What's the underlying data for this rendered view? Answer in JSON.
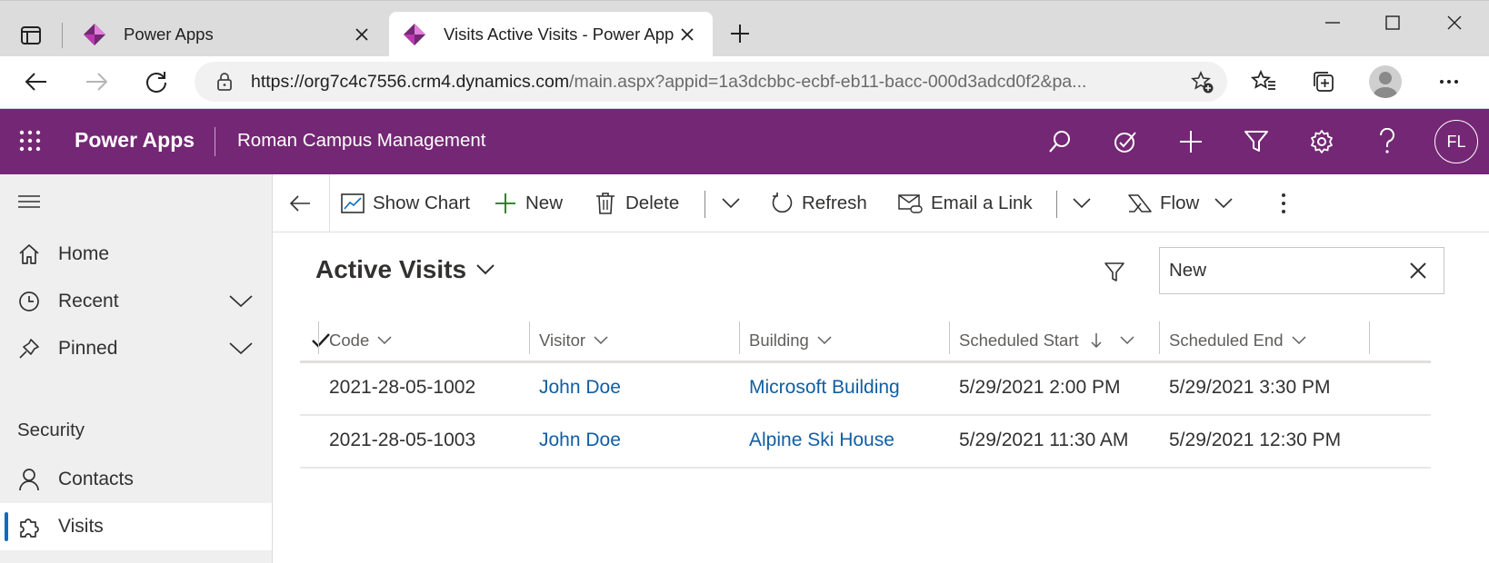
{
  "browser": {
    "tabs": [
      {
        "title": "Power Apps",
        "active": false
      },
      {
        "title": "Visits Active Visits - Power Apps",
        "active": true
      }
    ],
    "url_host": "https://org7c4c7556.crm4.dynamics.com",
    "url_rest": "/main.aspx?appid=1a3dcbbc-ecbf-eb11-bacc-000d3adcd0f2&pa..."
  },
  "app": {
    "name": "Power Apps",
    "environment": "Roman Campus Management",
    "user_initials": "FL",
    "header_color": "#742774"
  },
  "sidebar": {
    "items": [
      {
        "label": "Home",
        "icon": "home-icon"
      },
      {
        "label": "Recent",
        "icon": "clock-icon"
      },
      {
        "label": "Pinned",
        "icon": "pin-icon"
      }
    ],
    "group": "Security",
    "group_items": [
      {
        "label": "Contacts",
        "icon": "person-icon"
      },
      {
        "label": "Visits",
        "icon": "puzzle-icon",
        "selected": true
      }
    ]
  },
  "commands": {
    "show_chart": "Show Chart",
    "new": "New",
    "delete": "Delete",
    "refresh": "Refresh",
    "email_link": "Email a Link",
    "flow": "Flow"
  },
  "view": {
    "title": "Active Visits",
    "search_value": "New"
  },
  "grid": {
    "columns": [
      "Code",
      "Visitor",
      "Building",
      "Scheduled Start",
      "Scheduled End"
    ],
    "rows": [
      {
        "code": "2021-28-05-1002",
        "visitor": "John Doe",
        "building": "Microsoft Building",
        "start": "5/29/2021 2:00 PM",
        "end": "5/29/2021 3:30 PM"
      },
      {
        "code": "2021-28-05-1003",
        "visitor": "John Doe",
        "building": "Alpine Ski House",
        "start": "5/29/2021 11:30 AM",
        "end": "5/29/2021 12:30 PM"
      }
    ]
  }
}
